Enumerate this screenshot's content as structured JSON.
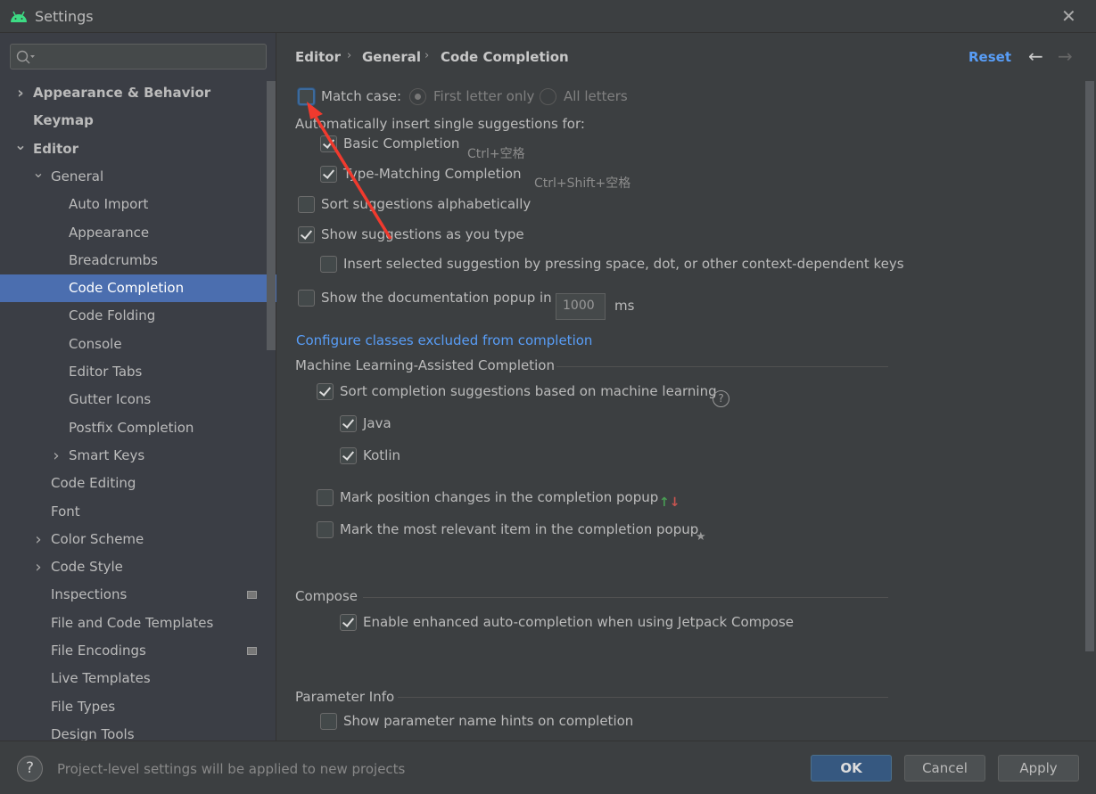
{
  "window": {
    "title": "Settings",
    "close_icon": "close-icon",
    "app_icon": "android-icon"
  },
  "sidebar": {
    "search_placeholder": "",
    "items": [
      {
        "label": "Appearance & Behavior",
        "level": 0,
        "chevron": "right",
        "bold": true
      },
      {
        "label": "Keymap",
        "level": 0,
        "bold": true
      },
      {
        "label": "Editor",
        "level": 0,
        "chevron": "down",
        "bold": true
      },
      {
        "label": "General",
        "level": 1,
        "chevron": "down"
      },
      {
        "label": "Auto Import",
        "level": 2
      },
      {
        "label": "Appearance",
        "level": 2
      },
      {
        "label": "Breadcrumbs",
        "level": 2
      },
      {
        "label": "Code Completion",
        "level": 2,
        "selected": true
      },
      {
        "label": "Code Folding",
        "level": 2
      },
      {
        "label": "Console",
        "level": 2
      },
      {
        "label": "Editor Tabs",
        "level": 2
      },
      {
        "label": "Gutter Icons",
        "level": 2
      },
      {
        "label": "Postfix Completion",
        "level": 2
      },
      {
        "label": "Smart Keys",
        "level": 2,
        "chevron": "right"
      },
      {
        "label": "Code Editing",
        "level": 1
      },
      {
        "label": "Font",
        "level": 1
      },
      {
        "label": "Color Scheme",
        "level": 1,
        "chevron": "right"
      },
      {
        "label": "Code Style",
        "level": 1,
        "chevron": "right"
      },
      {
        "label": "Inspections",
        "level": 1,
        "badge": true
      },
      {
        "label": "File and Code Templates",
        "level": 1
      },
      {
        "label": "File Encodings",
        "level": 1,
        "badge": true
      },
      {
        "label": "Live Templates",
        "level": 1
      },
      {
        "label": "File Types",
        "level": 1
      },
      {
        "label": "Design Tools",
        "level": 1
      }
    ]
  },
  "header": {
    "breadcrumb": [
      "Editor",
      "General",
      "Code Completion"
    ],
    "reset": "Reset",
    "back_icon": "arrow-left-icon",
    "forward_icon": "arrow-right-icon"
  },
  "options": {
    "match_case": {
      "label": "Match case:",
      "checked": false,
      "radios": [
        {
          "label": "First letter only",
          "selected": true
        },
        {
          "label": "All letters",
          "selected": false
        }
      ]
    },
    "auto_insert_heading": "Automatically insert single suggestions for:",
    "items": [
      {
        "label": "Basic Completion",
        "checked": true,
        "shortcut": "Ctrl+空格"
      },
      {
        "label": "Type-Matching Completion",
        "checked": true,
        "shortcut": "Ctrl+Shift+空格"
      },
      {
        "label": "Sort suggestions alphabetically",
        "checked": false
      },
      {
        "label": "Show suggestions as you type",
        "checked": true
      },
      {
        "label": "Insert selected suggestion by pressing space, dot, or other context-dependent keys",
        "checked": false
      },
      {
        "label": "Show the documentation popup in",
        "checked": false
      },
      {
        "label": "Sort completion suggestions based on machine learning",
        "checked": true
      },
      {
        "label": "Java",
        "checked": true
      },
      {
        "label": "Kotlin",
        "checked": true
      },
      {
        "label": "Mark position changes in the completion popup",
        "checked": false
      },
      {
        "label": "Mark the most relevant item in the completion popup",
        "checked": false
      },
      {
        "label": "Enable enhanced auto-completion when using Jetpack Compose",
        "checked": true
      },
      {
        "label": "Show parameter name hints on completion",
        "checked": false
      }
    ],
    "doc_popup_ms": "1000",
    "ms_unit": "ms",
    "configure_link": "Configure classes excluded from completion",
    "groups": [
      "Machine Learning-Assisted Completion",
      "Compose",
      "Parameter Info"
    ]
  },
  "footer": {
    "help_icon": "help-icon",
    "message": "Project-level settings will be applied to new projects",
    "ok": "OK",
    "cancel": "Cancel",
    "apply": "Apply"
  },
  "colors": {
    "selection": "#4b6eaf",
    "link": "#589df6",
    "ok_button": "#365880",
    "annotation_arrow": "#f03a2e",
    "up_arrow": "#499c54",
    "down_arrow": "#c75450"
  }
}
